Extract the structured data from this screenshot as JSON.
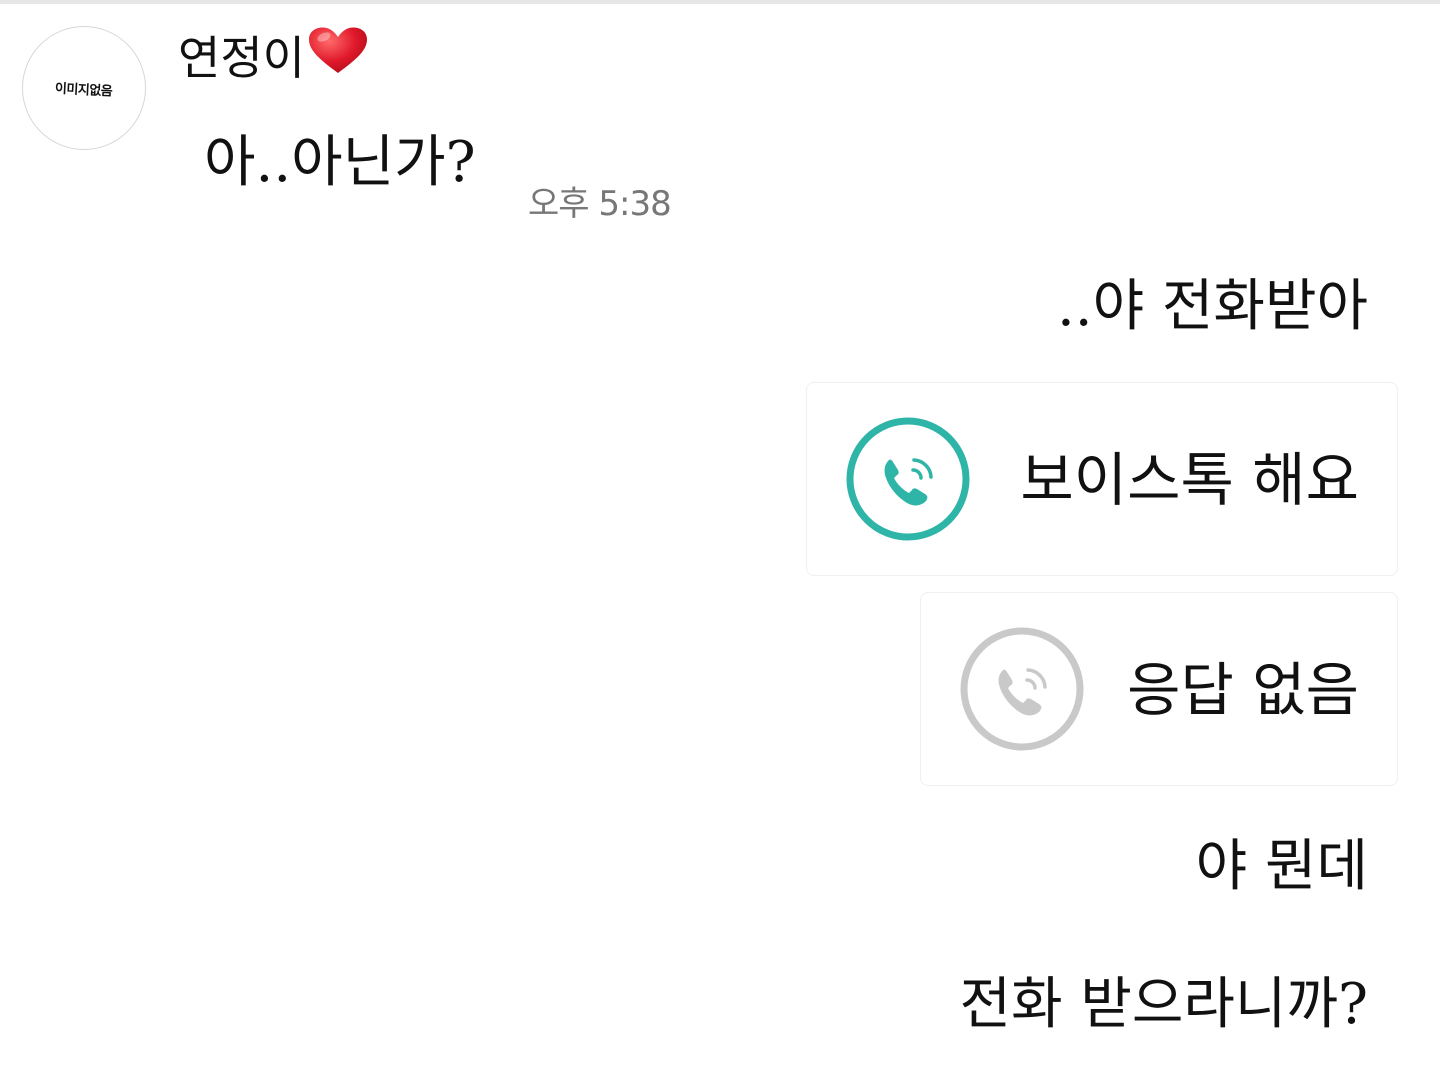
{
  "chat": {
    "sender": {
      "name": "연정이",
      "avatar_text": "이미지없음"
    },
    "messages": [
      {
        "side": "left",
        "text": "아..아닌가?",
        "time": "오후 5:38"
      },
      {
        "side": "right",
        "text": "..야 전화받아"
      },
      {
        "side": "right",
        "type": "call",
        "label": "보이스톡 해요",
        "status": "active"
      },
      {
        "side": "right",
        "type": "call",
        "label": "응답 없음",
        "status": "missed"
      },
      {
        "side": "right",
        "text": "야 뭔데"
      },
      {
        "side": "right",
        "text": "전화 받으라니까?"
      }
    ]
  },
  "colors": {
    "call_active": "#2eb5a8",
    "call_missed": "#c9c9c9",
    "heart": "#e0192b",
    "timestamp": "#777777"
  },
  "icons": {
    "heart": "heart-icon",
    "call_active": "phone-call-icon",
    "call_missed": "phone-missed-icon"
  }
}
